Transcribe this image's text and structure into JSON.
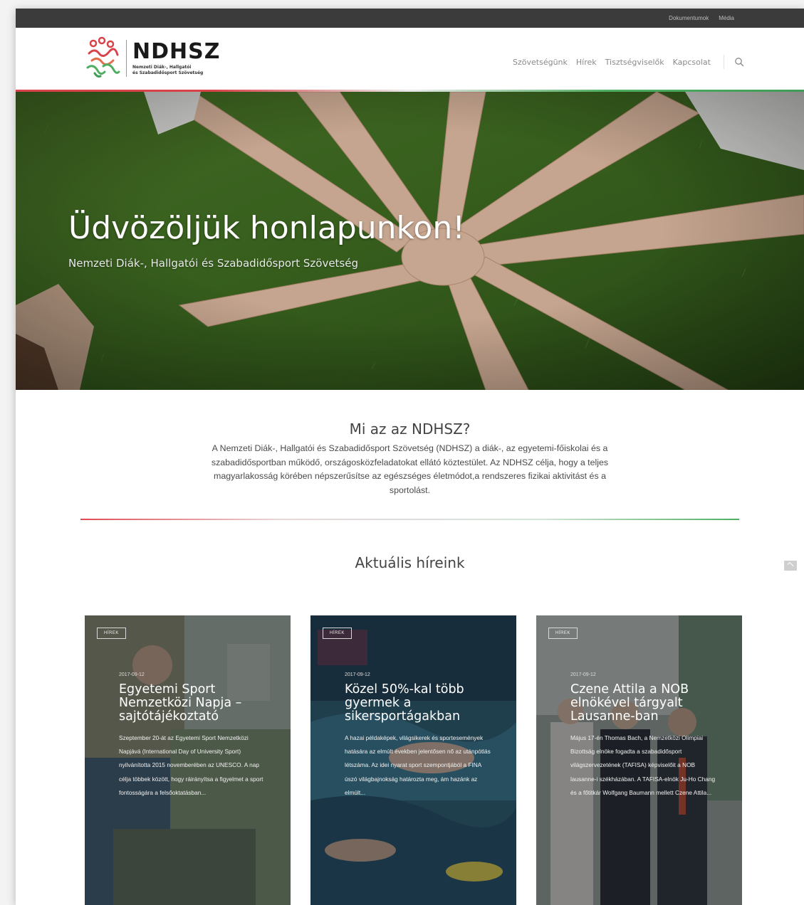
{
  "topbar": {
    "links": [
      "Dokumentumok",
      "Média"
    ]
  },
  "logo": {
    "name": "NDHSZ",
    "subtitle_line1": "Nemzeti Diák-, Hallgatói",
    "subtitle_line2": "és Szabadidősport Szövetség"
  },
  "nav": {
    "items": [
      "Szövetségünk",
      "Hírek",
      "Tisztségviselők",
      "Kapcsolat"
    ]
  },
  "hero": {
    "title": "Üdvözöljük honlapunkon!",
    "subtitle": "Nemzeti Diák-, Hallgatói és Szabadidősport Szövetség"
  },
  "about": {
    "title": "Mi az az NDHSZ?",
    "body": "A Nemzeti Diák-, Hallgatói és Szabadidősport Szövetség (NDHSZ) a diák-, az egyetemi-főiskolai és a szabadidősportban működő, országosközfeladatokat ellátó köztestület. Az NDHSZ célja, hogy a teljes magyarlakosság körében népszerűsítse az egészséges életmódot,a rendszeres fizikai aktivitást és a sportolást."
  },
  "news": {
    "title": "Aktuális híreink",
    "cards": [
      {
        "tag": "HÍREK",
        "date": "2017-09-12",
        "title": "Egyetemi Sport Nemzetközi Napja – sajtótájékoztató",
        "excerpt": "Szeptember 20-át az Egyetemi Sport Nemzetközi Napjává (International Day of University Sport) nyilvánította 2015 novemberében az UNESCO. A nap célja többek között, hogy ráirányítsa a figyelmet a sport fontosságára a felsőoktatásban..."
      },
      {
        "tag": "HÍREK",
        "date": "2017-09-12",
        "title": "Közel 50%-kal több gyermek a sikersportágakban",
        "excerpt": "A hazai példaképek, világsikerek és sportesemények hatására az elmúlt években jelentősen nő az utánpótlás létszáma. Az idei nyarat sport szempontjából a FINA úszó világbajnokság határozta meg, ám hazánk az elmúlt..."
      },
      {
        "tag": "HÍREK",
        "date": "2017-09-12",
        "title": "Czene Attila a NOB elnökével tárgyalt Lausanne-ban",
        "excerpt": "Május 17-én Thomas Bach, a Nemzetközi Olimpiai Bizottság elnöke fogadta a szabadidősport világszervezetének (TAFISA) képviselőit a NOB lausanne-i székházában. A TAFISA-elnök Ju-Ho Chang és a főtitkár Wolfgang Baumann mellett Czene Attila..."
      }
    ]
  },
  "colors": {
    "brand_red": "#d8434a",
    "brand_green": "#4fae62",
    "topbar": "#3b3b3b"
  }
}
